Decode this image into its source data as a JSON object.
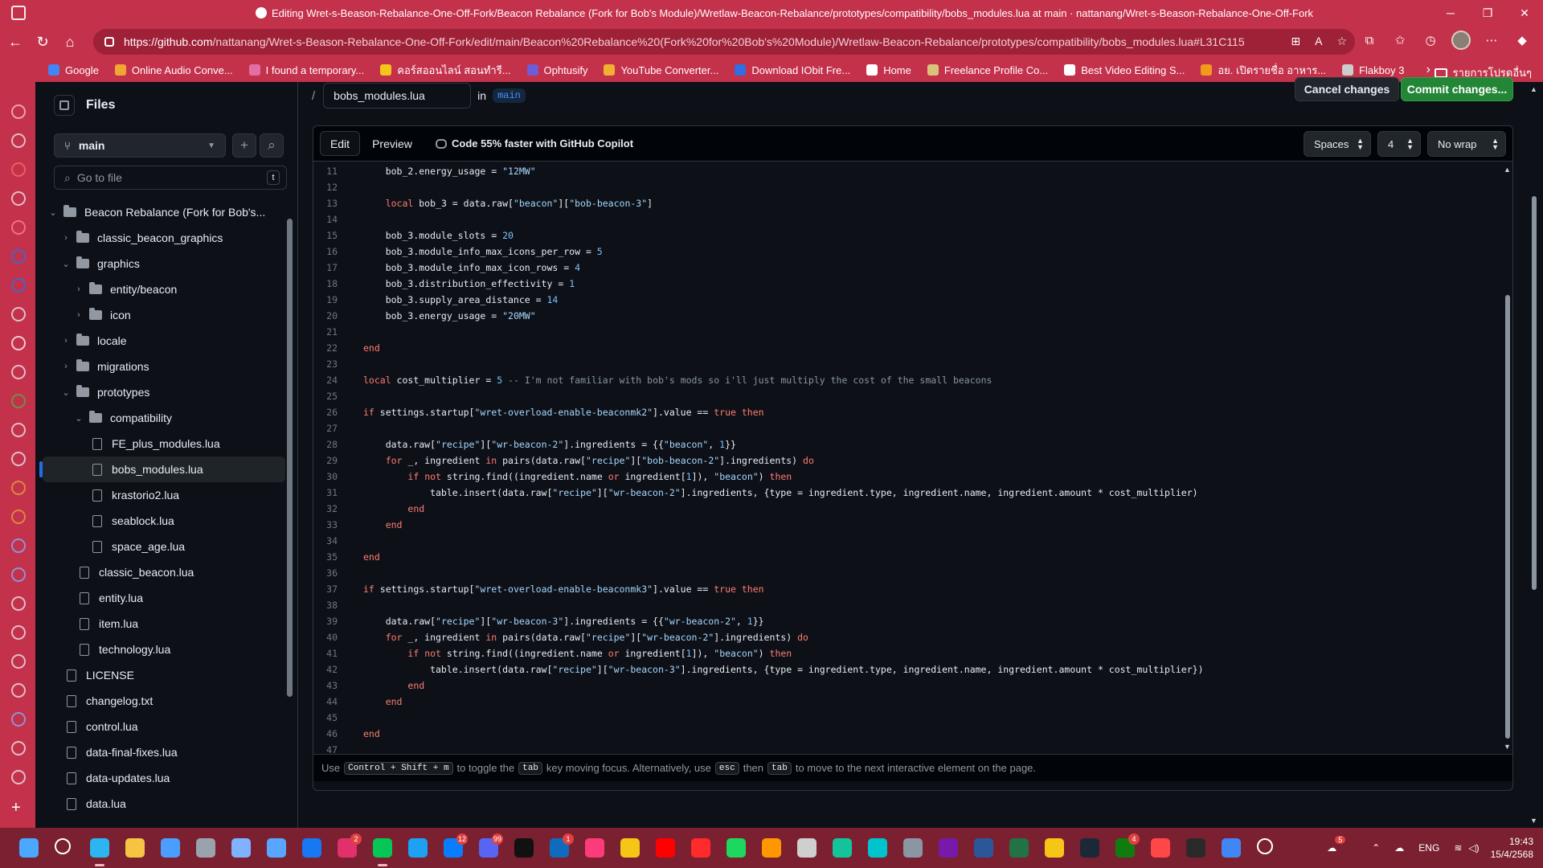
{
  "window": {
    "title": "Editing Wret-s-Beason-Rebalance-One-Off-Fork/Beacon Rebalance (Fork for Bob's Module)/Wretlaw-Beacon-Rebalance/prototypes/compatibility/bobs_modules.lua at main · nattanang/Wret-s-Beason-Rebalance-One-Off-Fork",
    "minimize": "─",
    "restore": "❐",
    "close": "✕"
  },
  "address": {
    "url_domain": "https://github.com",
    "url_path": "/nattanang/Wret-s-Beason-Rebalance-One-Off-Fork/edit/main/Beacon%20Rebalance%20(Fork%20for%20Bob's%20Module)/Wretlaw-Beacon-Rebalance/prototypes/compatibility/bobs_modules.lua#L31C115"
  },
  "bookmarks": [
    {
      "label": "Google",
      "color": "#4285f4"
    },
    {
      "label": "Online Audio Conve...",
      "color": "#f2a531"
    },
    {
      "label": "I found a temporary...",
      "color": "#e26ea3"
    },
    {
      "label": "คอร์สออนไลน์ สอนทำรี...",
      "color": "#f5c518"
    },
    {
      "label": "Ophtusify",
      "color": "#6e5dd6"
    },
    {
      "label": "YouTube Converter...",
      "color": "#f0b030"
    },
    {
      "label": "Download IObit Fre...",
      "color": "#2f6fe0"
    },
    {
      "label": "Home",
      "color": "#ffffff"
    },
    {
      "label": "Freelance Profile Co...",
      "color": "#d9c27a"
    },
    {
      "label": "Best Video Editing S...",
      "color": "#ffffff"
    },
    {
      "label": "อย. เปิดรายชื่อ อาหาร...",
      "color": "#f29a1e"
    },
    {
      "label": "Flakboy 3",
      "color": "#cccccc"
    }
  ],
  "bookmarks_other": "รายการโปรดอื่นๆ",
  "files_panel": {
    "title": "Files",
    "branch": "main",
    "goto_placeholder": "Go to file",
    "goto_shortcut": "t",
    "tree": [
      {
        "label": "Beacon Rebalance (Fork for Bob's...",
        "type": "folder",
        "depth": 0,
        "expanded": true
      },
      {
        "label": "classic_beacon_graphics",
        "type": "folder",
        "depth": 1,
        "expanded": false
      },
      {
        "label": "graphics",
        "type": "folder",
        "depth": 1,
        "expanded": true
      },
      {
        "label": "entity/beacon",
        "type": "folder",
        "depth": 2,
        "expanded": false
      },
      {
        "label": "icon",
        "type": "folder",
        "depth": 2,
        "expanded": false
      },
      {
        "label": "locale",
        "type": "folder",
        "depth": 1,
        "expanded": false
      },
      {
        "label": "migrations",
        "type": "folder",
        "depth": 1,
        "expanded": false
      },
      {
        "label": "prototypes",
        "type": "folder",
        "depth": 1,
        "expanded": true
      },
      {
        "label": "compatibility",
        "type": "folder",
        "depth": 2,
        "expanded": true
      },
      {
        "label": "FE_plus_modules.lua",
        "type": "file",
        "depth": 3
      },
      {
        "label": "bobs_modules.lua",
        "type": "file",
        "depth": 3,
        "selected": true
      },
      {
        "label": "krastorio2.lua",
        "type": "file",
        "depth": 3
      },
      {
        "label": "seablock.lua",
        "type": "file",
        "depth": 3
      },
      {
        "label": "space_age.lua",
        "type": "file",
        "depth": 3
      },
      {
        "label": "classic_beacon.lua",
        "type": "file",
        "depth": 2
      },
      {
        "label": "entity.lua",
        "type": "file",
        "depth": 2
      },
      {
        "label": "item.lua",
        "type": "file",
        "depth": 2
      },
      {
        "label": "technology.lua",
        "type": "file",
        "depth": 2
      },
      {
        "label": "LICENSE",
        "type": "file",
        "depth": 1
      },
      {
        "label": "changelog.txt",
        "type": "file",
        "depth": 1
      },
      {
        "label": "control.lua",
        "type": "file",
        "depth": 1
      },
      {
        "label": "data-final-fixes.lua",
        "type": "file",
        "depth": 1
      },
      {
        "label": "data-updates.lua",
        "type": "file",
        "depth": 1
      },
      {
        "label": "data.lua",
        "type": "file",
        "depth": 1
      }
    ]
  },
  "editor": {
    "separator": "/",
    "filename": "bobs_modules.lua",
    "in_label": "in",
    "branch": "main",
    "cancel_label": "Cancel changes",
    "commit_label": "Commit changes...",
    "tab_edit": "Edit",
    "tab_preview": "Preview",
    "copilot_note": "Code 55% faster with GitHub Copilot",
    "indent_mode": "Spaces",
    "indent_size": "4",
    "wrap_mode": "No wrap",
    "footer": {
      "use": "Use",
      "shortcut": "Control + Shift + m",
      "to_toggle": "to toggle the",
      "tab_key": "tab",
      "moving": "key moving focus. Alternatively, use",
      "esc_key": "esc",
      "then": "then",
      "tab_key2": "tab",
      "rest": "to move to the next interactive element on the page."
    },
    "code_lines": [
      {
        "n": "11",
        "html": "    bob_2.energy_usage = <span class=\"str\">\"12MW\"</span>"
      },
      {
        "n": "12",
        "html": ""
      },
      {
        "n": "13",
        "html": "    <span class=\"kw\">local</span> bob_3 = data.raw[<span class=\"str\">\"beacon\"</span>][<span class=\"str\">\"bob-beacon-3\"</span>]"
      },
      {
        "n": "14",
        "html": ""
      },
      {
        "n": "15",
        "html": "    bob_3.module_slots = <span class=\"n\">20</span>"
      },
      {
        "n": "16",
        "html": "    bob_3.module_info_max_icons_per_row = <span class=\"n\">5</span>"
      },
      {
        "n": "17",
        "html": "    bob_3.module_info_max_icon_rows = <span class=\"n\">4</span>"
      },
      {
        "n": "18",
        "html": "    bob_3.distribution_effectivity = <span class=\"n\">1</span>"
      },
      {
        "n": "19",
        "html": "    bob_3.supply_area_distance = <span class=\"n\">14</span>"
      },
      {
        "n": "20",
        "html": "    bob_3.energy_usage = <span class=\"str\">\"20MW\"</span>"
      },
      {
        "n": "21",
        "html": ""
      },
      {
        "n": "22",
        "html": "<span class=\"kw\">end</span>"
      },
      {
        "n": "23",
        "html": ""
      },
      {
        "n": "24",
        "html": "<span class=\"kw\">local</span> cost_multiplier = <span class=\"n\">5</span> <span class=\"cm\">-- I'm not familiar with bob's mods so i'll just multiply the cost of the small beacons</span>"
      },
      {
        "n": "25",
        "html": ""
      },
      {
        "n": "26",
        "html": "<span class=\"kw\">if</span> settings.startup[<span class=\"str\">\"wret-overload-enable-beaconmk2\"</span>].value == <span class=\"kw\">true</span> <span class=\"kw\">then</span>"
      },
      {
        "n": "27",
        "html": ""
      },
      {
        "n": "28",
        "html": "    data.raw[<span class=\"str\">\"recipe\"</span>][<span class=\"str\">\"wr-beacon-2\"</span>].ingredients = {{<span class=\"str\">\"beacon\"</span>, <span class=\"n\">1</span>}}"
      },
      {
        "n": "29",
        "html": "    <span class=\"kw\">for</span> _, ingredient <span class=\"kw\">in</span> pairs(data.raw[<span class=\"str\">\"recipe\"</span>][<span class=\"str\">\"bob-beacon-2\"</span>].ingredients) <span class=\"kw\">do</span>"
      },
      {
        "n": "30",
        "html": "        <span class=\"kw\">if</span> <span class=\"kw\">not</span> string.find((ingredient.name <span class=\"kw\">or</span> ingredient[<span class=\"n\">1</span>]), <span class=\"str\">\"beacon\"</span>) <span class=\"kw\">then</span>"
      },
      {
        "n": "31",
        "html": "            table.insert(data.raw[<span class=\"str\">\"recipe\"</span>][<span class=\"str\">\"wr-beacon-2\"</span>].ingredients, {type = ingredient.type, ingredient.name, ingredient.amount * cost_multiplier)"
      },
      {
        "n": "32",
        "html": "        <span class=\"kw\">end</span>"
      },
      {
        "n": "33",
        "html": "    <span class=\"kw\">end</span>"
      },
      {
        "n": "34",
        "html": ""
      },
      {
        "n": "35",
        "html": "<span class=\"kw\">end</span>"
      },
      {
        "n": "36",
        "html": ""
      },
      {
        "n": "37",
        "html": "<span class=\"kw\">if</span> settings.startup[<span class=\"str\">\"wret-overload-enable-beaconmk3\"</span>].value == <span class=\"kw\">true</span> <span class=\"kw\">then</span>"
      },
      {
        "n": "38",
        "html": ""
      },
      {
        "n": "39",
        "html": "    data.raw[<span class=\"str\">\"recipe\"</span>][<span class=\"str\">\"wr-beacon-3\"</span>].ingredients = {{<span class=\"str\">\"wr-beacon-2\"</span>, <span class=\"n\">1</span>}}"
      },
      {
        "n": "40",
        "html": "    <span class=\"kw\">for</span> _, ingredient <span class=\"kw\">in</span> pairs(data.raw[<span class=\"str\">\"recipe\"</span>][<span class=\"str\">\"wr-beacon-2\"</span>].ingredients) <span class=\"kw\">do</span>"
      },
      {
        "n": "41",
        "html": "        <span class=\"kw\">if</span> <span class=\"kw\">not</span> string.find((ingredient.name <span class=\"kw\">or</span> ingredient[<span class=\"n\">1</span>]), <span class=\"str\">\"beacon\"</span>) <span class=\"kw\">then</span>"
      },
      {
        "n": "42",
        "html": "            table.insert(data.raw[<span class=\"str\">\"recipe\"</span>][<span class=\"str\">\"wr-beacon-3\"</span>].ingredients, {type = ingredient.type, ingredient.name, ingredient.amount * cost_multiplier})"
      },
      {
        "n": "43",
        "html": "        <span class=\"kw\">end</span>"
      },
      {
        "n": "44",
        "html": "    <span class=\"kw\">end</span>"
      },
      {
        "n": "45",
        "html": ""
      },
      {
        "n": "46",
        "html": "<span class=\"kw\">end</span>"
      },
      {
        "n": "47",
        "html": ""
      }
    ]
  },
  "taskbar": {
    "icons": [
      {
        "name": "start-icon",
        "color": "#4aa8ff"
      },
      {
        "name": "search-icon",
        "color": "#ffffff"
      },
      {
        "name": "edge-icon",
        "color": "#2bb6f0",
        "active": true
      },
      {
        "name": "file-explorer-icon",
        "color": "#f6c343"
      },
      {
        "name": "store-icon",
        "color": "#4a9eff"
      },
      {
        "name": "settings-icon",
        "color": "#9aa3ad"
      },
      {
        "name": "copilot-icon",
        "color": "#7fb3ff"
      },
      {
        "name": "photos-icon",
        "color": "#58a6ff"
      },
      {
        "name": "facebook-icon",
        "color": "#1877f2"
      },
      {
        "name": "instagram-icon",
        "color": "#e1306c",
        "badge": "2"
      },
      {
        "name": "line-icon",
        "color": "#06c755",
        "active": true
      },
      {
        "name": "twitter-icon",
        "color": "#1da1f2"
      },
      {
        "name": "messenger-icon",
        "color": "#0a7cff",
        "badge": "12"
      },
      {
        "name": "discord-icon",
        "color": "#5865f2",
        "badge": "99"
      },
      {
        "name": "tiktok-icon",
        "color": "#111111"
      },
      {
        "name": "outlook-icon",
        "color": "#0f6cbd",
        "badge": "1"
      },
      {
        "name": "itunes-icon",
        "color": "#fc3c7a"
      },
      {
        "name": "autodesk-icon",
        "color": "#f5c518"
      },
      {
        "name": "youtube-icon",
        "color": "#ff0000"
      },
      {
        "name": "youtube-music-icon",
        "color": "#ff2a2a"
      },
      {
        "name": "spotify-icon",
        "color": "#1ed760"
      },
      {
        "name": "sublime-icon",
        "color": "#ff9800"
      },
      {
        "name": "davinci-icon",
        "color": "#cfcfcf"
      },
      {
        "name": "grammarly-icon",
        "color": "#15c39a"
      },
      {
        "name": "canva-icon",
        "color": "#00c4cc"
      },
      {
        "name": "calculator-icon",
        "color": "#8a96a3"
      },
      {
        "name": "onenote-icon",
        "color": "#7719aa"
      },
      {
        "name": "word-icon",
        "color": "#2b579a"
      },
      {
        "name": "excel-icon",
        "color": "#217346"
      },
      {
        "name": "plex-icon",
        "color": "#f5c518"
      },
      {
        "name": "steam-icon",
        "color": "#1b2838"
      },
      {
        "name": "xbox-icon",
        "color": "#107c10",
        "badge": "4"
      },
      {
        "name": "ea-icon",
        "color": "#ff4747"
      },
      {
        "name": "epic-games-icon",
        "color": "#2a2a2a"
      },
      {
        "name": "chrome-icon",
        "color": "#4285f4"
      },
      {
        "name": "more-apps-icon",
        "color": "#ffffff"
      }
    ],
    "tray_badge": "5",
    "language": "ENG",
    "time": "19:43",
    "date": "15/4/2568"
  }
}
